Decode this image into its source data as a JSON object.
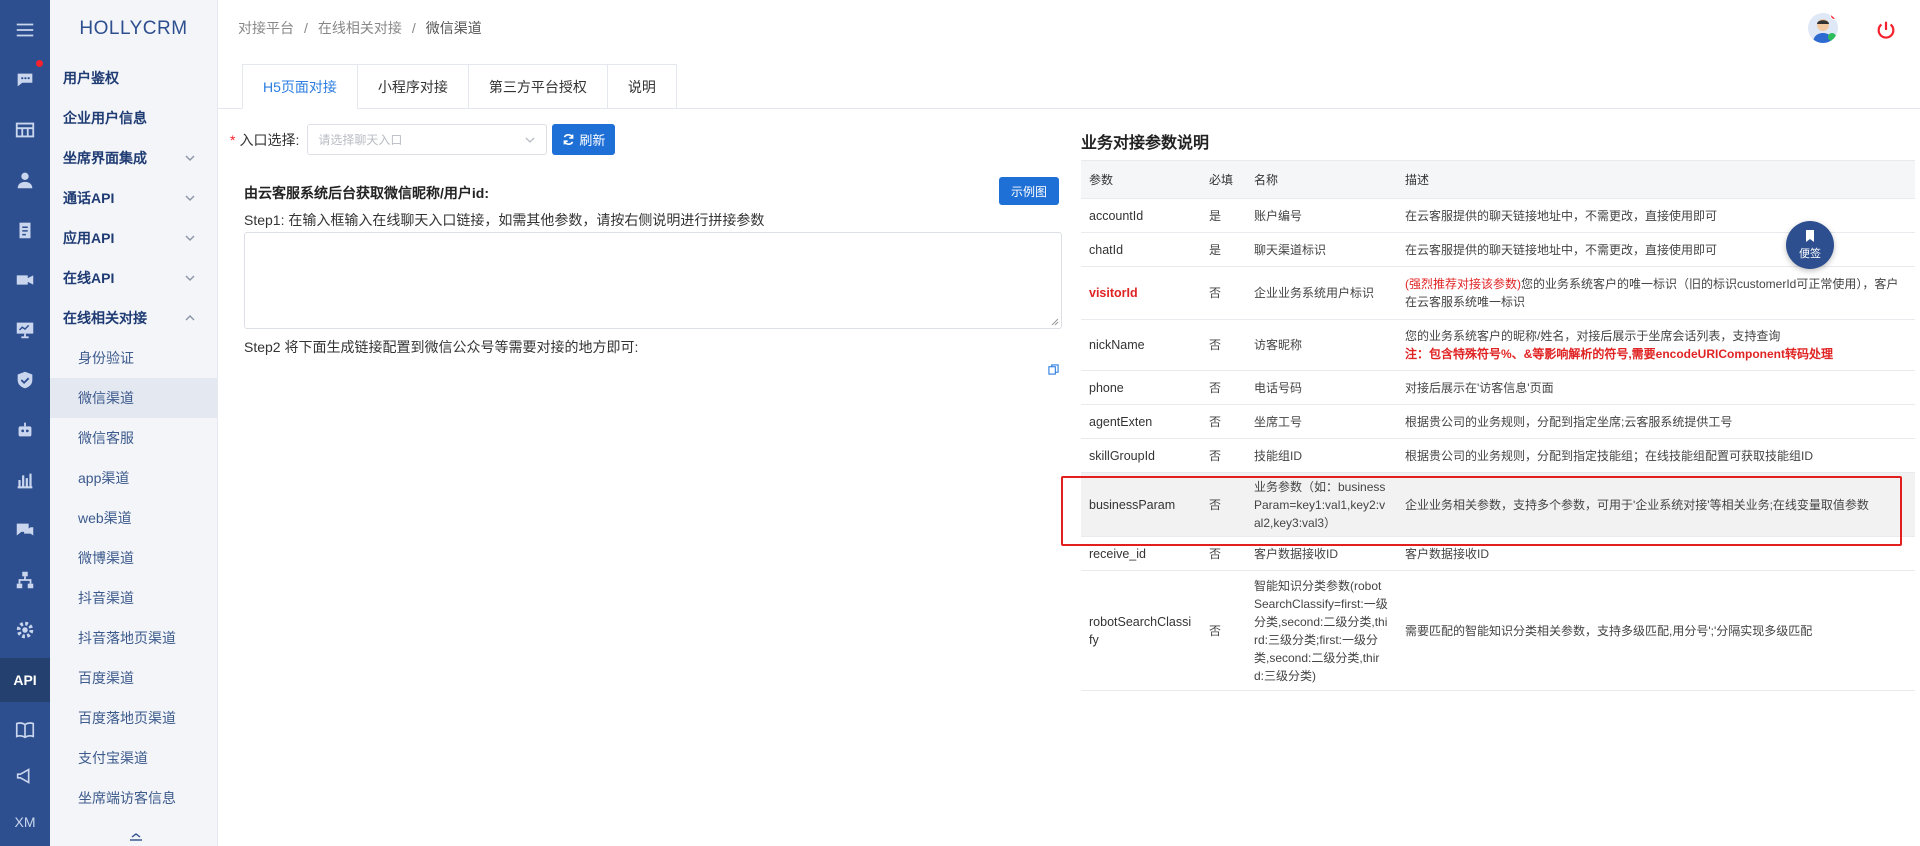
{
  "app": {
    "logo": "HOLLYCRM"
  },
  "rail": {
    "api_label": "API",
    "xm_label": "XM"
  },
  "sidebar": {
    "items": [
      {
        "label": "用户鉴权"
      },
      {
        "label": "企业用户信息"
      },
      {
        "label": "坐席界面集成"
      },
      {
        "label": "通话API"
      },
      {
        "label": "应用API"
      },
      {
        "label": "在线API"
      },
      {
        "label": "在线相关对接"
      }
    ],
    "subitems": [
      {
        "label": "身份验证"
      },
      {
        "label": "微信渠道"
      },
      {
        "label": "微信客服"
      },
      {
        "label": "app渠道"
      },
      {
        "label": "web渠道"
      },
      {
        "label": "微博渠道"
      },
      {
        "label": "抖音渠道"
      },
      {
        "label": "抖音落地页渠道"
      },
      {
        "label": "百度渠道"
      },
      {
        "label": "百度落地页渠道"
      },
      {
        "label": "支付宝渠道"
      },
      {
        "label": "坐席端访客信息"
      }
    ]
  },
  "breadcrumb": {
    "level1": "对接平台",
    "level2": "在线相关对接",
    "level3": "微信渠道",
    "sep": "/"
  },
  "tabs": [
    {
      "label": "H5页面对接"
    },
    {
      "label": "小程序对接"
    },
    {
      "label": "第三方平台授权"
    },
    {
      "label": "说明"
    }
  ],
  "form": {
    "required_mark": "*",
    "entry_label": "入口选择:",
    "entry_placeholder": "请选择聊天入口",
    "refresh_label": "刷新",
    "hint_title": "由云客服系统后台获取微信昵称/用户id:",
    "example_label": "示例图",
    "step1": "Step1: 在输入框输入在线聊天入口链接，如需其他参数，请按右侧说明进行拼接参数",
    "step2": "Step2 将下面生成链接配置到微信公众号等需要对接的地方即可:"
  },
  "params": {
    "title": "业务对接参数说明",
    "headers": {
      "param": "参数",
      "required": "必填",
      "name": "名称",
      "desc": "描述"
    },
    "rows": [
      {
        "param": "accountId",
        "required": "是",
        "name": "账户编号",
        "desc": "在云客服提供的聊天链接地址中，不需更改，直接使用即可"
      },
      {
        "param": "chatId",
        "required": "是",
        "name": "聊天渠道标识",
        "desc": "在云客服提供的聊天链接地址中，不需更改，直接使用即可"
      },
      {
        "param": "visitorId",
        "required": "否",
        "name": "企业业务系统用户标识",
        "desc_red": "(强烈推荐对接该参数)",
        "desc": "您的业务系统客户的唯一标识（旧的标识customerId可正常使用），客户在云客服系统唯一标识"
      },
      {
        "param": "nickName",
        "required": "否",
        "name": "访客昵称",
        "desc": "您的业务系统客户的昵称/姓名，对接后展示于坐席会话列表，支持查询",
        "desc_note": "注：包含特殊符号%、&等影响解析的符号,需要encodeURIComponent转码处理"
      },
      {
        "param": "phone",
        "required": "否",
        "name": "电话号码",
        "desc": "对接后展示在'访客信息'页面"
      },
      {
        "param": "agentExten",
        "required": "否",
        "name": "坐席工号",
        "desc": "根据贵公司的业务规则，分配到指定坐席;云客服系统提供工号"
      },
      {
        "param": "skillGroupId",
        "required": "否",
        "name": "技能组ID",
        "desc": "根据贵公司的业务规则，分配到指定技能组；在线技能组配置可获取技能组ID"
      },
      {
        "param": "businessParam",
        "required": "否",
        "name": "业务参数（如：businessParam=key1:val1,key2:val2,key3:val3）",
        "desc": "企业业务相关参数，支持多个参数，可用于'企业系统对接'等相关业务;在线变量取值参数"
      },
      {
        "param": "receive_id",
        "required": "否",
        "name": "客户数据接收ID",
        "desc": "客户数据接收ID"
      },
      {
        "param": "robotSearchClassify",
        "required": "否",
        "name": "智能知识分类参数(robotSearchClassify=first:一级分类,second:二级分类,third:三级分类;first:一级分类,second:二级分类,third:三级分类)",
        "desc": "需要匹配的智能知识分类相关参数，支持多级匹配,用分号';'分隔实现多级匹配"
      }
    ]
  },
  "note_button": {
    "label": "便签"
  },
  "colors": {
    "rail": "#2e4f8f",
    "primary": "#1f70d6",
    "highlight": "#e21f1f",
    "active_tab": "#2b7de0"
  }
}
